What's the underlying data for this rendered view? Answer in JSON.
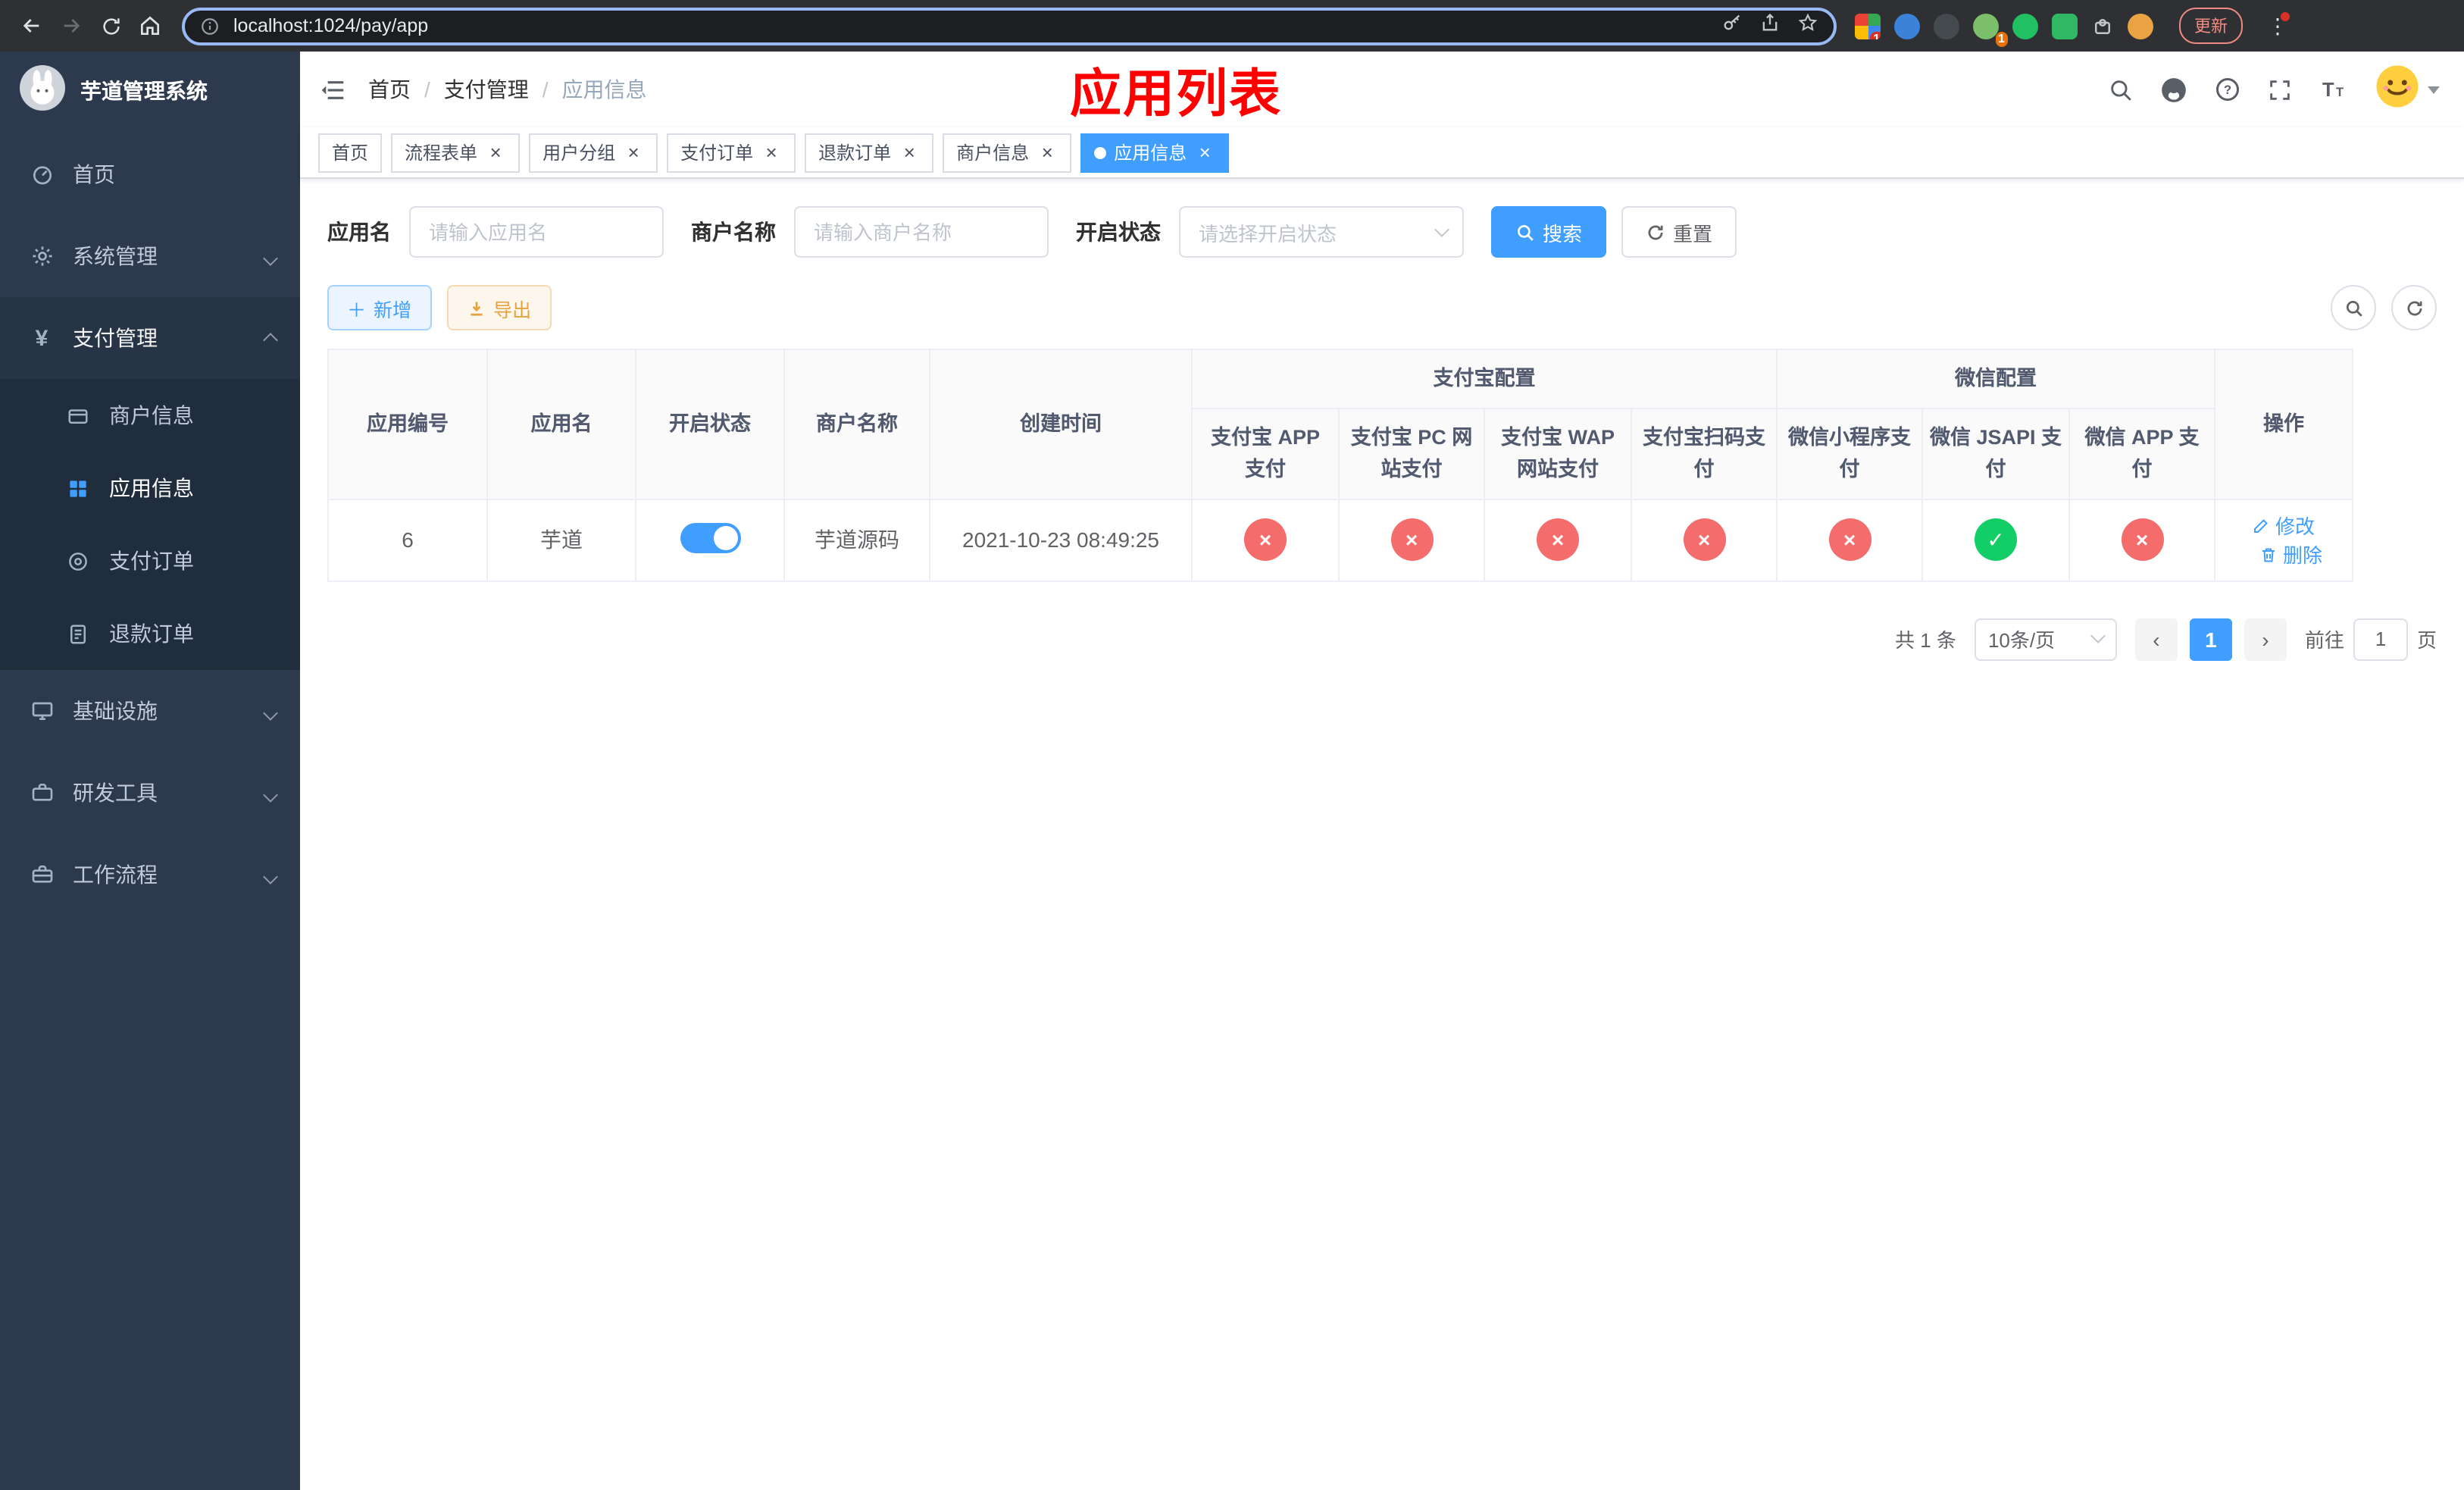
{
  "colors": {
    "accent": "#409eff",
    "danger": "#f56c6c",
    "success": "#13ce66",
    "warning": "#e6a23c",
    "annotation_red": "#fe0000",
    "sidebar_bg": "#2d3a4d",
    "sidebar_submenu_bg": "#1f2d3d"
  },
  "icons": {
    "close": "×",
    "check": "✓",
    "cross": "×",
    "plus": "＋",
    "prev": "‹",
    "next": "›"
  },
  "browser": {
    "url": "localhost:1024/pay/app",
    "extension_badge": "10",
    "avatar_badge": "1",
    "update_button": "更新"
  },
  "sidebar": {
    "title": "芋道管理系统",
    "menu": [
      {
        "label": "首页"
      },
      {
        "label": "系统管理"
      },
      {
        "label": "支付管理",
        "children": [
          {
            "label": "商户信息"
          },
          {
            "label": "应用信息",
            "active": true
          },
          {
            "label": "支付订单"
          },
          {
            "label": "退款订单"
          }
        ]
      },
      {
        "label": "基础设施"
      },
      {
        "label": "研发工具"
      },
      {
        "label": "工作流程"
      }
    ]
  },
  "header": {
    "breadcrumb": [
      "首页",
      "支付管理",
      "应用信息"
    ],
    "separator": "/",
    "annotation_title": "应用列表"
  },
  "tabs": [
    {
      "label": "首页",
      "closable": false,
      "active": false
    },
    {
      "label": "流程表单",
      "closable": true,
      "active": false
    },
    {
      "label": "用户分组",
      "closable": true,
      "active": false
    },
    {
      "label": "支付订单",
      "closable": true,
      "active": false
    },
    {
      "label": "退款订单",
      "closable": true,
      "active": false
    },
    {
      "label": "商户信息",
      "closable": true,
      "active": false
    },
    {
      "label": "应用信息",
      "closable": true,
      "active": true
    }
  ],
  "filters": {
    "app_name": {
      "label": "应用名",
      "placeholder": "请输入应用名",
      "value": ""
    },
    "merchant_name": {
      "label": "商户名称",
      "placeholder": "请输入商户名称",
      "value": ""
    },
    "status": {
      "label": "开启状态",
      "placeholder": "请选择开启状态",
      "value": ""
    },
    "search_button": "搜索",
    "reset_button": "重置"
  },
  "toolbar": {
    "add_button": "新增",
    "export_button": "导出"
  },
  "table": {
    "headers": {
      "app_id": "应用编号",
      "app_name": "应用名",
      "status": "开启状态",
      "merchant_name": "商户名称",
      "create_time": "创建时间",
      "alipay_group": "支付宝配置",
      "wechat_group": "微信配置",
      "actions": "操作"
    },
    "channel_headers": [
      "支付宝 APP 支付",
      "支付宝 PC 网站支付",
      "支付宝 WAP 网站支付",
      "支付宝扫码支付",
      "微信小程序支付",
      "微信 JSAPI 支付",
      "微信 APP 支付"
    ],
    "rows": [
      {
        "app_id": "6",
        "app_name": "芋道",
        "status_on": true,
        "merchant_name": "芋道源码",
        "create_time": "2021-10-23 08:49:25",
        "channels": [
          false,
          false,
          false,
          false,
          false,
          true,
          false
        ],
        "edit_label": "修改",
        "delete_label": "删除"
      }
    ]
  },
  "pagination": {
    "total": "共 1 条",
    "page_size": "10条/页",
    "current_page": "1",
    "goto_label": "前往",
    "goto_value": "1",
    "goto_unit": "页"
  }
}
